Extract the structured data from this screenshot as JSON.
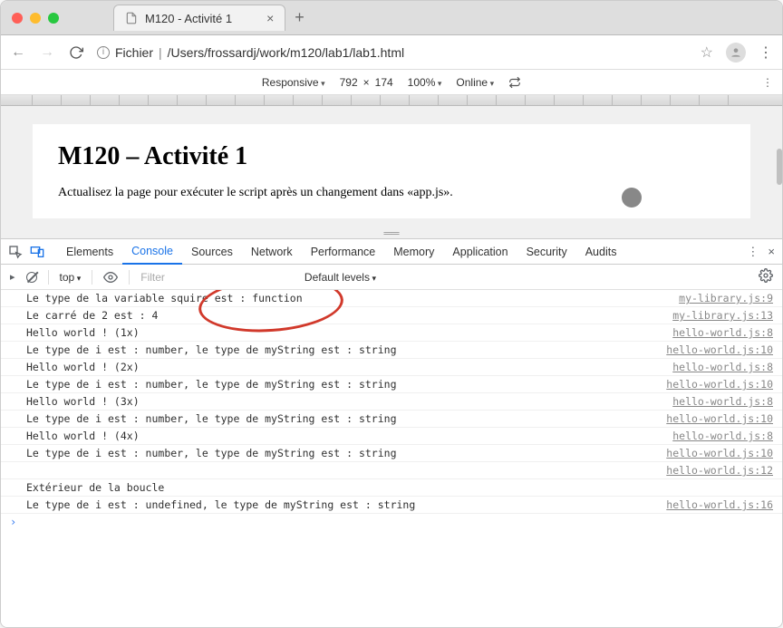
{
  "titlebar": {
    "tab_title": "M120 - Activité 1"
  },
  "urlbar": {
    "prefix": "Fichier",
    "path": "/Users/frossardj/work/m120/lab1/lab1.html"
  },
  "devicebar": {
    "mode": "Responsive",
    "width": "792",
    "sep": "×",
    "height": "174",
    "zoom": "100%",
    "throttle": "Online"
  },
  "page": {
    "heading": "M120 – Activité 1",
    "body": "Actualisez la page pour exécuter le script après un changement dans «app.js»."
  },
  "devtools": {
    "tabs": [
      "Elements",
      "Console",
      "Sources",
      "Network",
      "Performance",
      "Memory",
      "Application",
      "Security",
      "Audits"
    ],
    "active_tab": "Console",
    "toolbar": {
      "context": "top",
      "filter_placeholder": "Filter",
      "levels": "Default levels"
    },
    "logs": [
      {
        "msg": "Le type de la variable squire est : function",
        "src": "my-library.js:9"
      },
      {
        "msg": "Le carré de 2 est : 4",
        "src": "my-library.js:13"
      },
      {
        "msg": "Hello world ! (1x)",
        "src": "hello-world.js:8"
      },
      {
        "msg": "Le type de i est : number, le type de myString est : string",
        "src": "hello-world.js:10"
      },
      {
        "msg": "Hello world ! (2x)",
        "src": "hello-world.js:8"
      },
      {
        "msg": "Le type de i est : number, le type de myString est : string",
        "src": "hello-world.js:10"
      },
      {
        "msg": "Hello world ! (3x)",
        "src": "hello-world.js:8"
      },
      {
        "msg": "Le type de i est : number, le type de myString est : string",
        "src": "hello-world.js:10"
      },
      {
        "msg": "Hello world ! (4x)",
        "src": "hello-world.js:8"
      },
      {
        "msg": "Le type de i est : number, le type de myString est : string",
        "src": "hello-world.js:10"
      },
      {
        "msg": "",
        "src": "hello-world.js:12"
      },
      {
        "msg": "Extérieur de la boucle",
        "src": ""
      },
      {
        "msg": "Le type de i est : undefined, le type de myString est : string",
        "src": "hello-world.js:16"
      }
    ]
  }
}
